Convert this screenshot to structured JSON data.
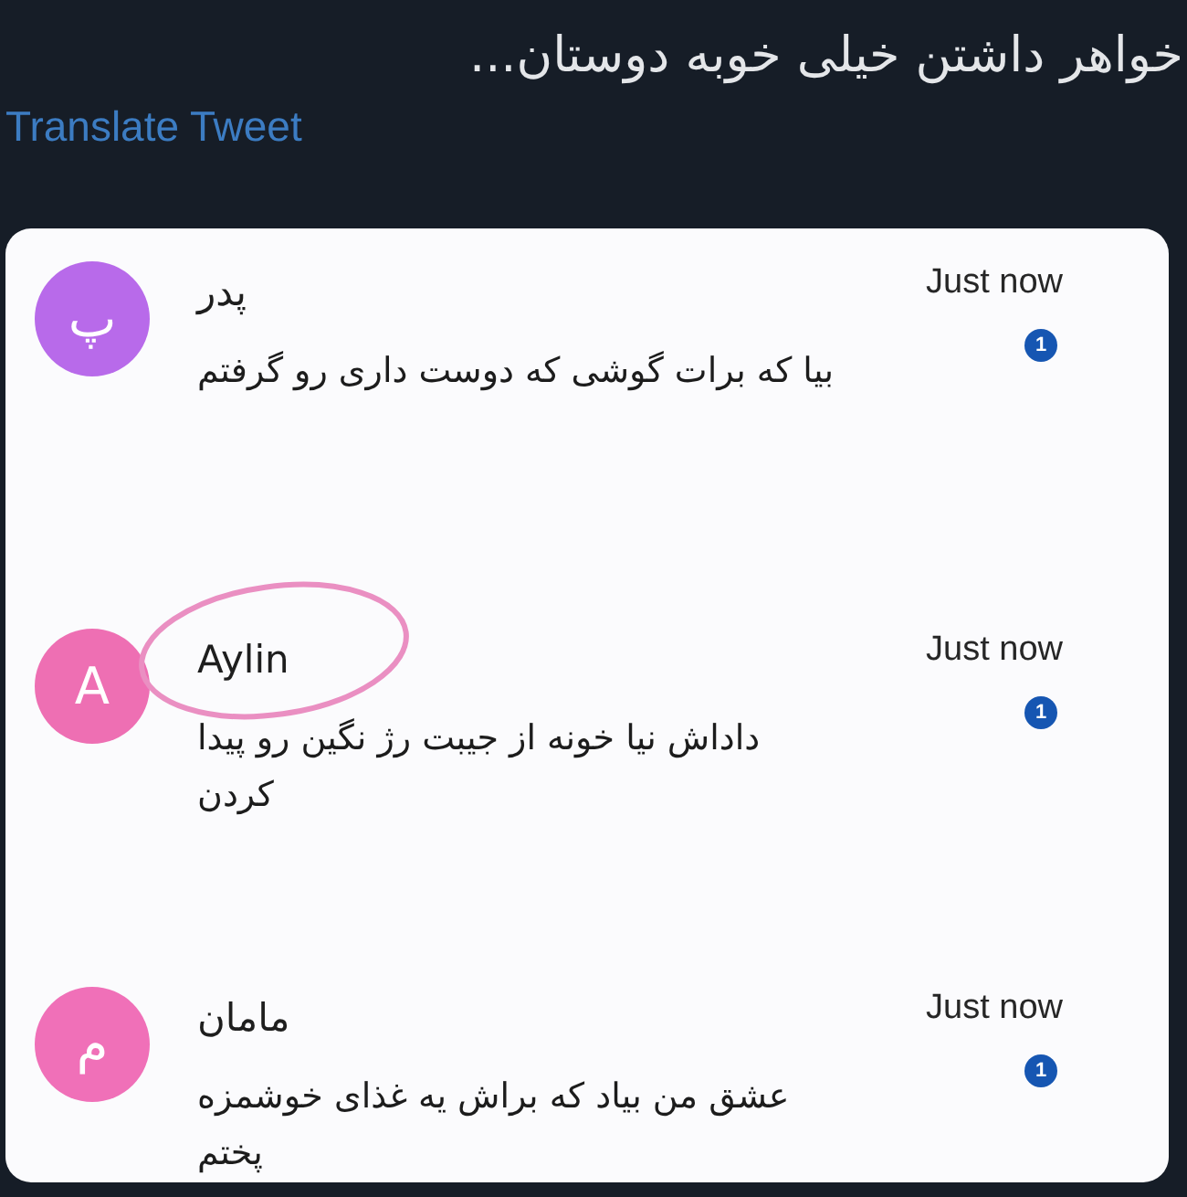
{
  "tweet": {
    "text": "خواهر داشتن خیلی خوبه دوستان...",
    "translate_link": "Translate Tweet"
  },
  "notifications": [
    {
      "avatar_letter": "پ",
      "color": "#b86aea",
      "sender": "پدر",
      "message": "بیا که برات گوشی که دوست داری رو گرفتم",
      "time": "Just now",
      "unread_count": "1",
      "circled": false
    },
    {
      "avatar_letter": "A",
      "color": "#ee6fb3",
      "sender": "Aylin",
      "message": "داداش نیا خونه از جیبت رژ نگین رو پیدا کردن",
      "time": "Just now",
      "unread_count": "1",
      "circled": true
    },
    {
      "avatar_letter": "م",
      "color": "#f070b8",
      "sender": "مامان",
      "message": "عشق من بیاد که براش یه غذای خوشمزه پختم",
      "time": "Just now",
      "unread_count": "1",
      "circled": false
    }
  ]
}
